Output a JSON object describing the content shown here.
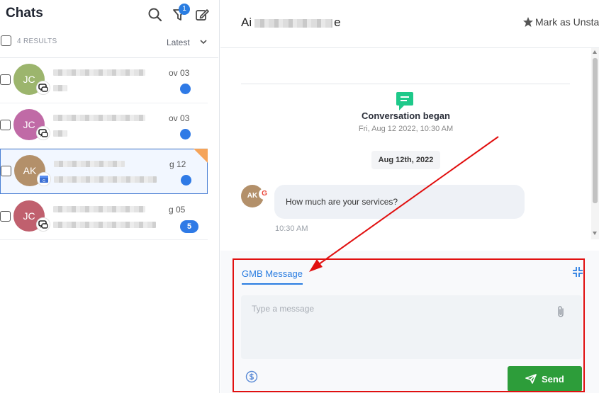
{
  "left_panel": {
    "title": "Chats",
    "filter_badge_count": "1",
    "results_label": "4 RESULTS",
    "sort_label": "Latest",
    "chats": [
      {
        "initials": "JC",
        "avatar_color": "#9cb56d",
        "date": "ov 03",
        "unread": "dot",
        "channel": "chat-bubble-icon"
      },
      {
        "initials": "JC",
        "avatar_color": "#c06aa6",
        "date": "ov 03",
        "unread": "dot",
        "channel": "chat-bubble-icon"
      },
      {
        "initials": "AK",
        "avatar_color": "#b3906a",
        "date": "g 12",
        "unread": "dot",
        "channel": "gmb-icon",
        "selected": true,
        "starred": true
      },
      {
        "initials": "JC",
        "avatar_color": "#c0606e",
        "date": "g 05",
        "unread": "5",
        "channel": "chat-bubble-icon"
      }
    ]
  },
  "conversation": {
    "contact_name": "Ai",
    "contact_name_tail": "e",
    "mark_unstar_label": "Mark as Unsta",
    "event_title": "Conversation began",
    "event_timestamp": "Fri, Aug 12 2022, 10:30 AM",
    "date_chip": "Aug 12th, 2022",
    "message": {
      "avatar_initials": "AK",
      "channel_icon": "G",
      "text": "How much are your services?",
      "time": "10:30 AM"
    }
  },
  "composer": {
    "tab_label": "GMB Message",
    "placeholder": "Type a message",
    "send_label": "Send"
  },
  "colors": {
    "accent_blue": "#2a7de1",
    "send_green": "#2d9d3a",
    "annotation_red": "#e11010",
    "event_icon_green": "#1ec98a"
  }
}
